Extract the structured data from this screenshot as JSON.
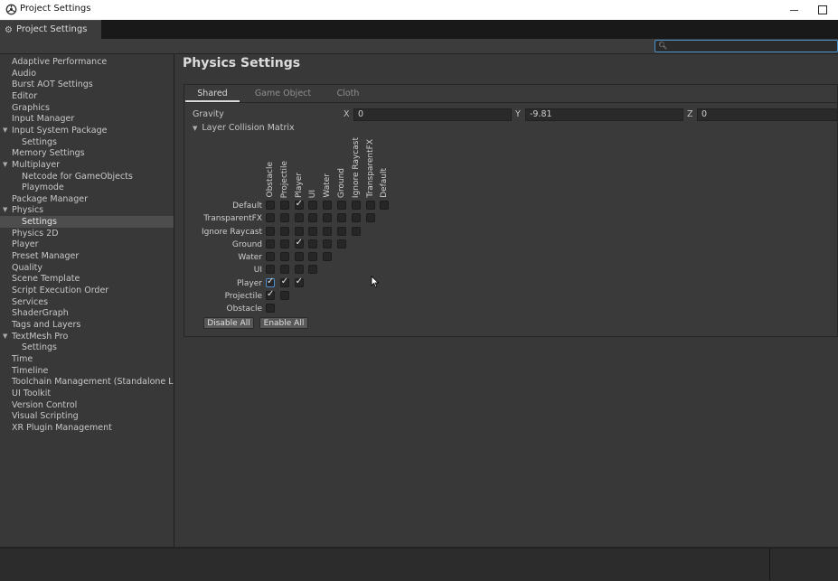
{
  "window": {
    "title": "Project Settings"
  },
  "tab": {
    "label": "Project Settings"
  },
  "search": {
    "value": "",
    "placeholder": ""
  },
  "sidebar": {
    "items": [
      {
        "label": "Adaptive Performance"
      },
      {
        "label": "Audio"
      },
      {
        "label": "Burst AOT Settings"
      },
      {
        "label": "Editor"
      },
      {
        "label": "Graphics"
      },
      {
        "label": "Input Manager"
      },
      {
        "label": "Input System Package",
        "expanded": true
      },
      {
        "label": "Settings",
        "child": true
      },
      {
        "label": "Memory Settings"
      },
      {
        "label": "Multiplayer",
        "expanded": true
      },
      {
        "label": "Netcode for GameObjects",
        "child": true
      },
      {
        "label": "Playmode",
        "child": true
      },
      {
        "label": "Package Manager"
      },
      {
        "label": "Physics",
        "expanded": true
      },
      {
        "label": "Settings",
        "child": true,
        "selected": true
      },
      {
        "label": "Physics 2D"
      },
      {
        "label": "Player"
      },
      {
        "label": "Preset Manager"
      },
      {
        "label": "Quality"
      },
      {
        "label": "Scene Template"
      },
      {
        "label": "Script Execution Order"
      },
      {
        "label": "Services"
      },
      {
        "label": "ShaderGraph"
      },
      {
        "label": "Tags and Layers"
      },
      {
        "label": "TextMesh Pro",
        "expanded": true
      },
      {
        "label": "Settings",
        "child": true
      },
      {
        "label": "Time"
      },
      {
        "label": "Timeline"
      },
      {
        "label": "Toolchain Management (Standalone Lin"
      },
      {
        "label": "UI Toolkit"
      },
      {
        "label": "Version Control"
      },
      {
        "label": "Visual Scripting"
      },
      {
        "label": "XR Plugin Management"
      }
    ]
  },
  "main": {
    "title": "Physics Settings",
    "subtabs": [
      {
        "label": "Shared",
        "active": true
      },
      {
        "label": "Game Object"
      },
      {
        "label": "Cloth"
      }
    ],
    "gravity": {
      "label": "Gravity",
      "x_label": "X",
      "x": "0",
      "y_label": "Y",
      "y": "-9.81",
      "z_label": "Z",
      "z": "0"
    },
    "matrix": {
      "header": "Layer Collision Matrix",
      "layers": [
        "Default",
        "TransparentFX",
        "Ignore Raycast",
        "Ground",
        "Water",
        "UI",
        "Player",
        "Projectile",
        "Obstacle"
      ],
      "checked": [
        [
          "Default",
          "Player"
        ],
        [
          "Ground",
          "Player"
        ],
        [
          "Player",
          "Player"
        ],
        [
          "Player",
          "Projectile"
        ],
        [
          "Player",
          "Obstacle"
        ],
        [
          "Projectile",
          "Obstacle"
        ]
      ],
      "focused": [
        "Player",
        "Obstacle"
      ],
      "disable_all": "Disable All",
      "enable_all": "Enable All"
    }
  }
}
